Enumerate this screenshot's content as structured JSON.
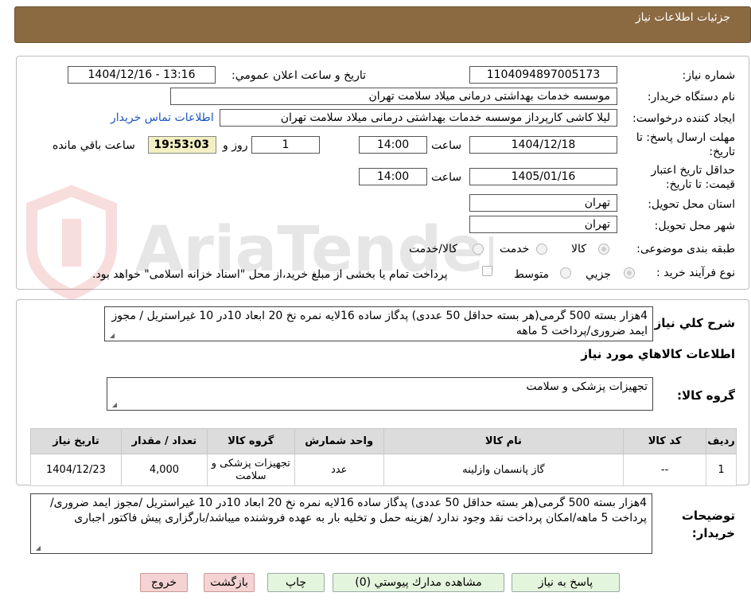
{
  "header": {
    "title": "جزئیات اطلاعات نیاز"
  },
  "watermark": {
    "text": "AriaTender.neT"
  },
  "form": {
    "need_number_label": "شماره نیاز:",
    "need_number": "1104094897005173",
    "announce_label": "تاریخ و ساعت اعلان عمومي:",
    "announce_value": "1404/12/16 - 13:16",
    "buyer_org_label": "نام دستگاه خریدار:",
    "buyer_org": "موسسه خدمات بهداشتی درمانی میلاد سلامت تهران",
    "requester_label": "ایجاد کننده درخواست:",
    "requester": "لیلا کاشی کارپرداز موسسه خدمات بهداشتی درمانی میلاد سلامت تهران",
    "contact_link": "اطلاعات تماس خریدار",
    "deadline_label": "مهلت ارسال پاسخ: تا تاریخ:",
    "deadline_date": "1404/12/18",
    "time_label": "ساعت",
    "deadline_time": "14:00",
    "days_value": "1",
    "days_label": "روز و",
    "remaining_time": "19:53:03",
    "remaining_label": "ساعت باقي مانده",
    "price_validity_label": "حداقل تاریخ اعتبار قیمت: تا تاریخ:",
    "price_validity_date": "1405/01/16",
    "price_validity_time": "14:00",
    "province_label": "استان محل تحویل:",
    "province": "تهران",
    "city_label": "شهر محل تحویل:",
    "city": "تهران",
    "category_label": "طبقه بندی موضوعی:",
    "category_options": [
      "کالا",
      "خدمت",
      "کالا/خدمت"
    ],
    "category_selected": "کالا",
    "process_label": "نوع فرآیند خرید :",
    "process_options": [
      "جزیي",
      "متوسط"
    ],
    "process_selected": "جزیي",
    "payment_note": "پرداخت تمام یا بخشی از مبلغ خرید،از محل \"اسناد خزانه اسلامی\" خواهد بود."
  },
  "summary": {
    "label": "شرح کلي نیاز:",
    "text": "4هزار بسته 500 گرمی(هر بسته حداقل 50 عددی) پدگاز ساده 16لایه نمره نخ 20 ابعاد 10در 10 غیراستریل / مجوز ایمد ضروری/پرداخت 5 ماهه"
  },
  "goods": {
    "section_title": "اطلاعات کالاهاي مورد نیاز",
    "group_label": "گروه کالا:",
    "group_value": "تجهیزات پزشکی و سلامت",
    "table_headers": [
      "ردیف",
      "کد کالا",
      "نام کالا",
      "واحد شمارش",
      "گروه کالا",
      "تعداد / مقدار",
      "تاریخ نیاز"
    ],
    "rows": [
      [
        "1",
        "--",
        "گاز پانسمان وازلینه",
        "عدد",
        "تجهیزات پزشکی و سلامت",
        "4,000",
        "1404/12/23"
      ]
    ]
  },
  "buyer_notes": {
    "label": "توضیحات خریدار:",
    "text": "4هزار بسته 500 گرمی(هر بسته حداقل 50 عددی) پدگاز ساده 16لایه نمره نخ 20 ابعاد 10در 10 غیراستریل /مجوز ایمد ضروری/پرداخت 5 ماهه/امکان پرداخت نقد وجود ندارد /هزینه حمل و تخلیه بار به عهده فروشنده میباشد/بارگزاری پیش فاکتور اجباری"
  },
  "buttons": {
    "reply": "پاسخ به نیاز",
    "attachments": "مشاهده مدارك پیوستي (0)",
    "print": "چاپ",
    "back": "بازگشت",
    "exit": "خروج"
  },
  "colors": {
    "header_bg": "#8b6a42",
    "timer_bg": "#f3efc3",
    "link": "#1a55c2",
    "btn_green": "#e4f5dd",
    "btn_pink": "#f6d3d3"
  }
}
